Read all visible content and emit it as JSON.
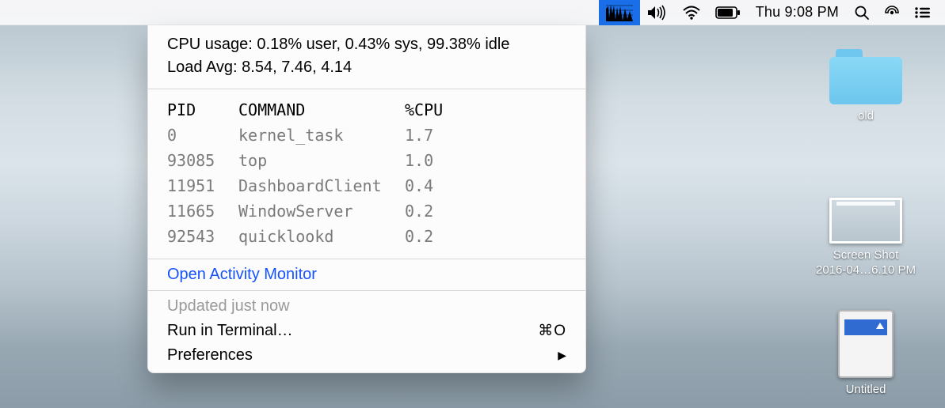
{
  "menubar": {
    "clock": "Thu 9:08 PM"
  },
  "panel": {
    "summary": {
      "cpu_line": "CPU usage: 0.18% user, 0.43% sys, 99.38% idle",
      "load_line": "Load Avg: 8.54, 7.46, 4.14"
    },
    "headers": {
      "pid": "PID",
      "cmd": "COMMAND",
      "cpu": "%CPU"
    },
    "processes": [
      {
        "pid": "0",
        "cmd": "kernel_task",
        "cpu": "1.7"
      },
      {
        "pid": "93085",
        "cmd": "top",
        "cpu": "1.0"
      },
      {
        "pid": "11951",
        "cmd": "DashboardClient",
        "cpu": "0.4"
      },
      {
        "pid": "11665",
        "cmd": "WindowServer",
        "cpu": "0.2"
      },
      {
        "pid": "92543",
        "cmd": "quicklookd",
        "cpu": "0.2"
      }
    ],
    "open_activity_monitor": "Open Activity Monitor",
    "updated": "Updated just now",
    "run_in_terminal": "Run in Terminal…",
    "run_shortcut": "⌘O",
    "preferences": "Preferences"
  },
  "desktop": {
    "folder_label": "old",
    "screenshot_label_1": "Screen Shot",
    "screenshot_label_2": "2016-04…6.10 PM",
    "disk_label": "Untitled"
  }
}
